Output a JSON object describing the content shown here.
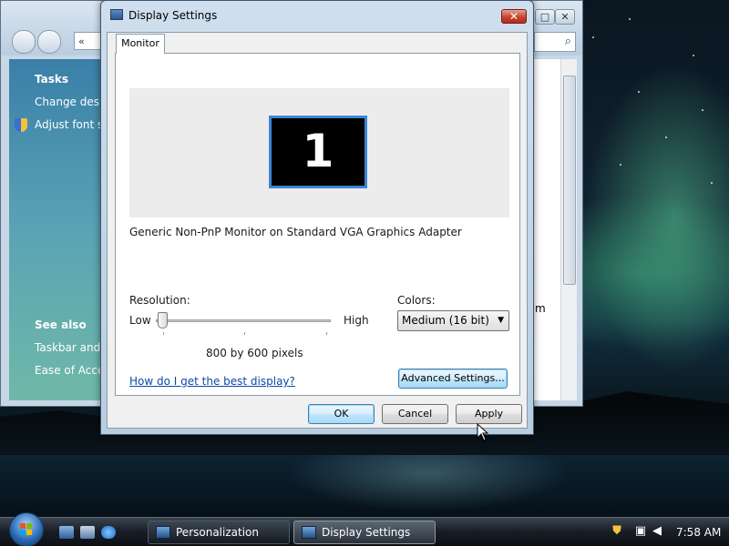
{
  "background_window": {
    "address_text": "«",
    "side_pane": {
      "tasks_heading": "Tasks",
      "task_items": [
        "Change deskt",
        "Adjust font siz"
      ],
      "see_also_heading": "See also",
      "see_also_items": [
        "Taskbar and S",
        "Ease of Acces"
      ]
    },
    "content_fragment": "m"
  },
  "dialog": {
    "title": "Display Settings",
    "close_glyph": "✕",
    "tab_label": "Monitor",
    "monitor_number": "1",
    "adapter_text": "Generic Non-PnP Monitor on Standard VGA Graphics Adapter",
    "resolution": {
      "label": "Resolution:",
      "low_label": "Low",
      "high_label": "High",
      "value_text": "800 by 600 pixels",
      "slider_level": 0
    },
    "colors": {
      "label": "Colors:",
      "selected": "Medium (16 bit)"
    },
    "help_link": "How do I get the best display?",
    "advanced_button": "Advanced Settings...",
    "buttons": {
      "ok": "OK",
      "cancel": "Cancel",
      "apply": "Apply"
    }
  },
  "taskbar": {
    "tasks": [
      {
        "label": "Personalization",
        "active": false
      },
      {
        "label": "Display Settings",
        "active": true
      }
    ],
    "clock": "7:58 AM"
  },
  "colors": {
    "link": "#0b4aa8",
    "close_button": "#c8442e",
    "monitor_border": "#3b85d6"
  }
}
